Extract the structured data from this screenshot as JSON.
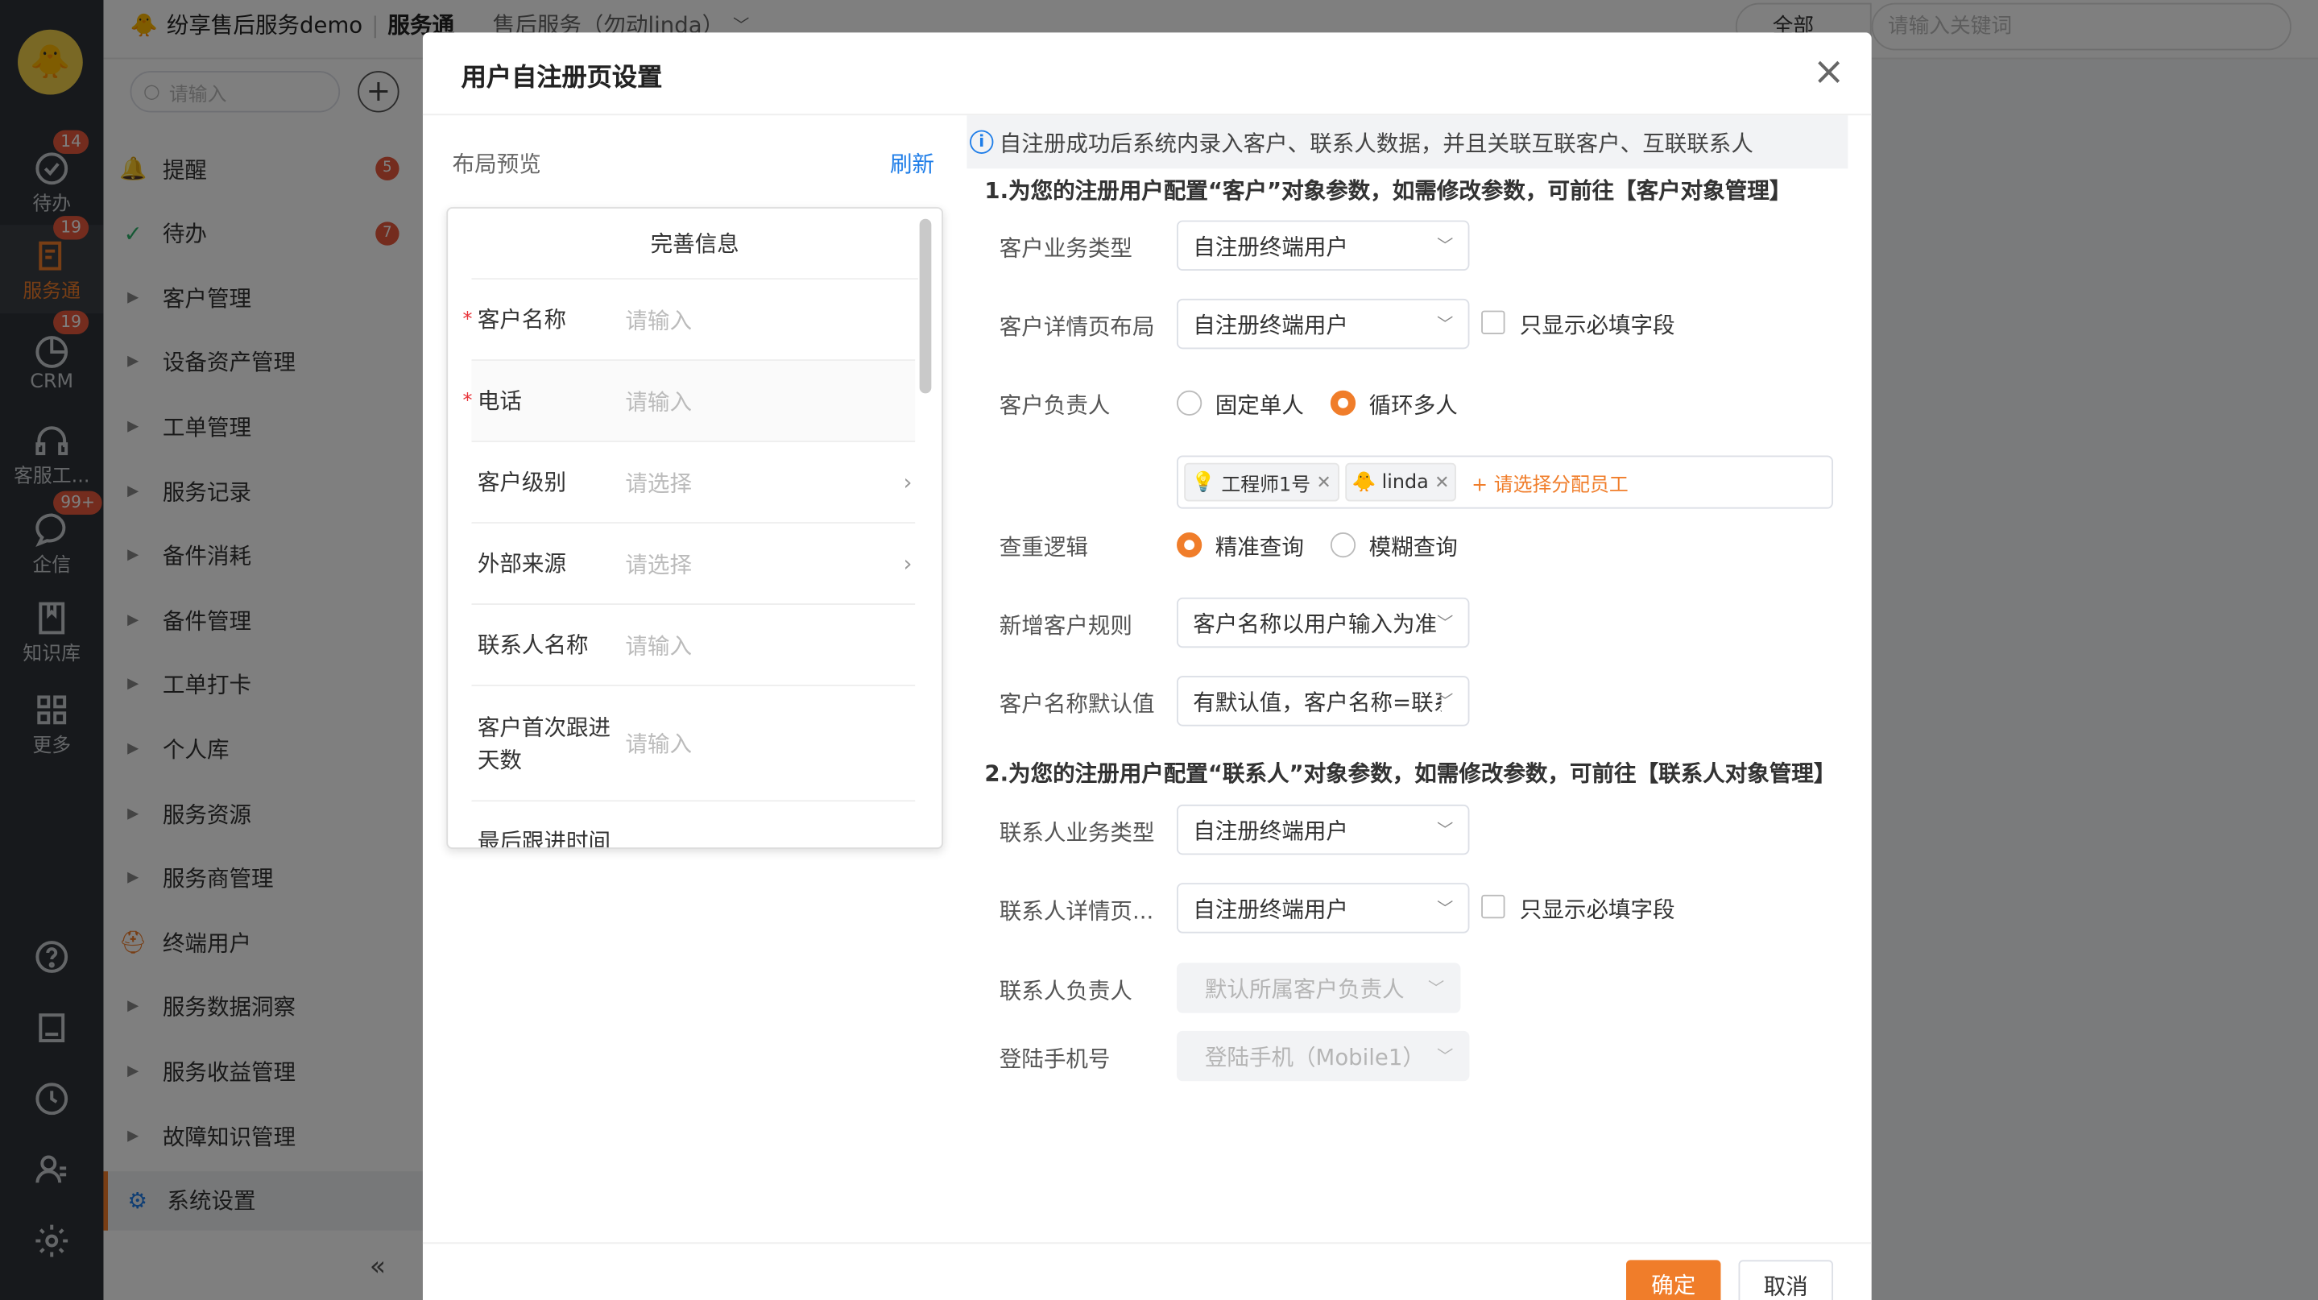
{
  "app": {
    "brand": "纷享售后服务demo",
    "module": "服务通",
    "tenant": "售后服务（勿动linda）"
  },
  "topsearch": {
    "scope": "全部",
    "placeholder": "请输入关键词"
  },
  "rail": {
    "items": [
      {
        "label": "待办",
        "badge": "14"
      },
      {
        "label": "服务通",
        "badge": "19"
      },
      {
        "label": "CRM",
        "badge": "19"
      },
      {
        "label": "客服工...",
        "badge": ""
      },
      {
        "label": "企信",
        "badge": "99+"
      },
      {
        "label": "知识库",
        "badge": ""
      },
      {
        "label": "更多",
        "badge": ""
      }
    ]
  },
  "sidebar": {
    "search_placeholder": "请输入",
    "items": [
      {
        "label": "提醒",
        "badge": "5"
      },
      {
        "label": "待办",
        "badge": "7"
      },
      {
        "label": "客户管理"
      },
      {
        "label": "设备资产管理"
      },
      {
        "label": "工单管理"
      },
      {
        "label": "服务记录"
      },
      {
        "label": "备件消耗"
      },
      {
        "label": "备件管理"
      },
      {
        "label": "工单打卡"
      },
      {
        "label": "个人库"
      },
      {
        "label": "服务资源"
      },
      {
        "label": "服务商管理"
      },
      {
        "label": "终端用户"
      },
      {
        "label": "服务数据洞察"
      },
      {
        "label": "服务收益管理"
      },
      {
        "label": "故障知识管理"
      },
      {
        "label": "系统设置"
      }
    ],
    "collapse": "«"
  },
  "modal": {
    "title": "用户自注册页设置",
    "close": "×",
    "preview_label": "布局预览",
    "refresh": "刷新",
    "phone": {
      "title": "完善信息",
      "rows": [
        {
          "label": "客户名称",
          "value": "请输入",
          "required": true
        },
        {
          "label": "电话",
          "value": "请输入",
          "required": true
        },
        {
          "label": "客户级别",
          "value": "请选择",
          "arrow": true
        },
        {
          "label": "外部来源",
          "value": "请选择",
          "arrow": true
        },
        {
          "label": "联系人名称",
          "value": "请输入"
        },
        {
          "label": "客户首次跟进天数",
          "value": "请输入"
        },
        {
          "label": "最后跟进时间",
          "value": ""
        }
      ]
    },
    "notice": "自注册成功后系统内录入客户、联系人数据，并且关联互联客户、互联联系人",
    "section1": "1.为您的注册用户配置“客户”对象参数，如需修改参数，可前往【客户对象管理】",
    "customer": {
      "biz_type_label": "客户业务类型",
      "biz_type": "自注册终端用户",
      "layout_label": "客户详情页布局",
      "layout": "自注册终端用户",
      "only_required": "只显示必填字段",
      "owner_label": "客户负责人",
      "owner_opt1": "固定单人",
      "owner_opt2": "循环多人",
      "tags": [
        "工程师1号",
        "linda"
      ],
      "tag_add": "+ 请选择分配员工",
      "dedup_label": "查重逻辑",
      "dedup_opt1": "精准查询",
      "dedup_opt2": "模糊查询",
      "new_rule_label": "新增客户规则",
      "new_rule": "客户名称以用户输入为准",
      "default_name_label": "客户名称默认值",
      "default_name": "有默认值，客户名称=联系人名称"
    },
    "section2": "2.为您的注册用户配置“联系人”对象参数，如需修改参数，可前往【联系人对象管理】",
    "contact": {
      "biz_type_label": "联系人业务类型",
      "biz_type": "自注册终端用户",
      "layout_label": "联系人详情页...",
      "layout": "自注册终端用户",
      "only_required": "只显示必填字段",
      "owner_label": "联系人负责人",
      "owner": "默认所属客户负责人",
      "phone_label": "登陆手机号",
      "phone": "登陆手机（Mobile1）"
    },
    "ok": "确定",
    "cancel": "取消"
  },
  "colors": {
    "accent": "#f07d2a",
    "link": "#1e7de8",
    "badge": "#e8593c"
  }
}
